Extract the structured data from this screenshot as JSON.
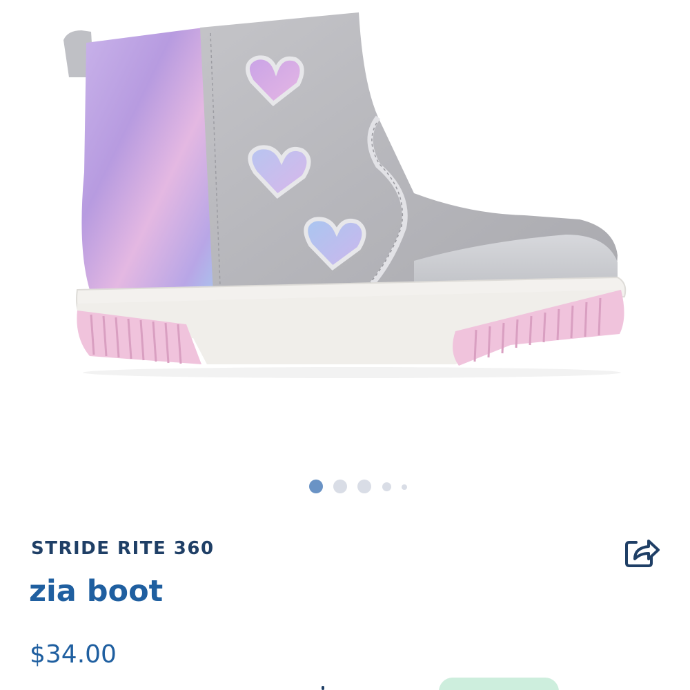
{
  "product": {
    "image_icon": "zia-boot-photo",
    "brand": "STRIDE RITE 360",
    "name": "zia boot",
    "price": "$34.00"
  },
  "carousel": {
    "total_images": 5,
    "active_index": 0
  },
  "actions": {
    "share_icon": "share-icon"
  },
  "colors": {
    "brand_navy": "#1f3f66",
    "accent_blue": "#1f5fa0",
    "dot_active": "#6a93c5",
    "dot_inactive": "#d9dde6",
    "badge_mint": "#cdeedd"
  }
}
